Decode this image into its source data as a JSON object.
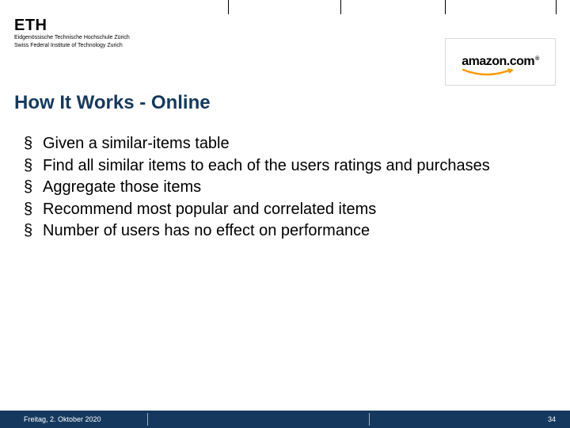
{
  "header": {
    "eth_main": "ETH",
    "eth_sub1": "Eidgenössische Technische Hochschule Zürich",
    "eth_sub2": "Swiss Federal Institute of Technology Zurich",
    "amazon_text": "amazon.com",
    "amazon_reg": "®"
  },
  "title": "How It Works - Online",
  "bullets": [
    "Given a similar-items table",
    "Find all similar items to each of the users ratings and purchases",
    "Aggregate those items",
    "Recommend most popular and correlated items",
    "Number of users has no effect on performance"
  ],
  "footer": {
    "date": "Freitag, 2. Oktober 2020",
    "page": "34"
  }
}
